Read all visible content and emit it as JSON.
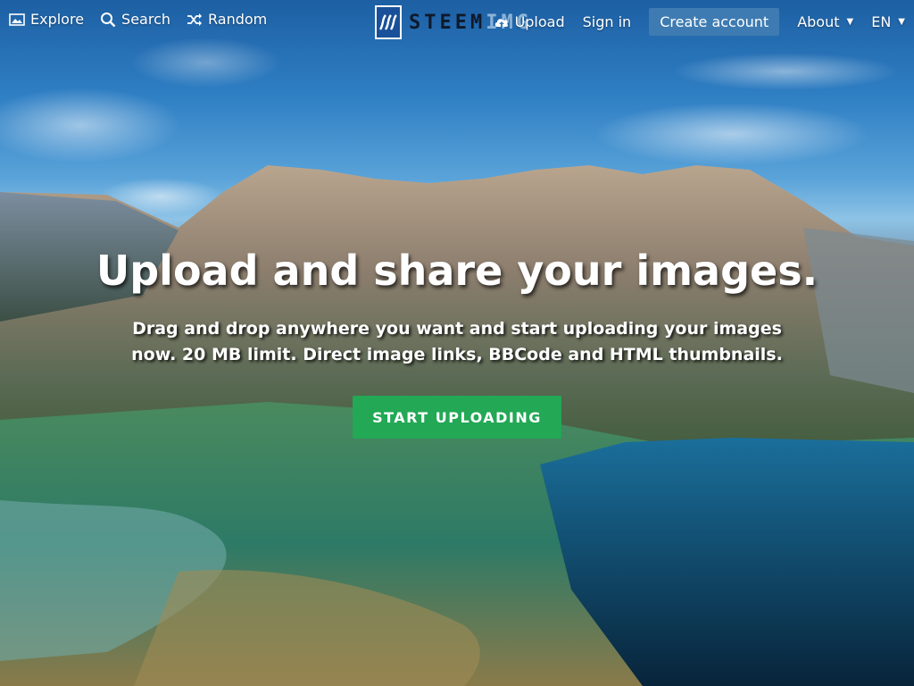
{
  "nav": {
    "explore": "Explore",
    "search": "Search",
    "random": "Random"
  },
  "logo": {
    "text_part1": "STEEM",
    "text_part2": "IMG"
  },
  "header": {
    "upload": "Upload",
    "sign_in": "Sign in",
    "create_account": "Create account",
    "about": "About",
    "language": "EN"
  },
  "hero": {
    "title": "Upload and share your images.",
    "subtitle": "Drag and drop anywhere you want and start uploading your images now. 20 MB limit. Direct image links, BBCode and HTML thumbnails.",
    "cta": "START UPLOADING"
  },
  "colors": {
    "cta": "#23a856",
    "create_account_bg": "#3e7bb2",
    "logo_badge": "#1a5099"
  }
}
